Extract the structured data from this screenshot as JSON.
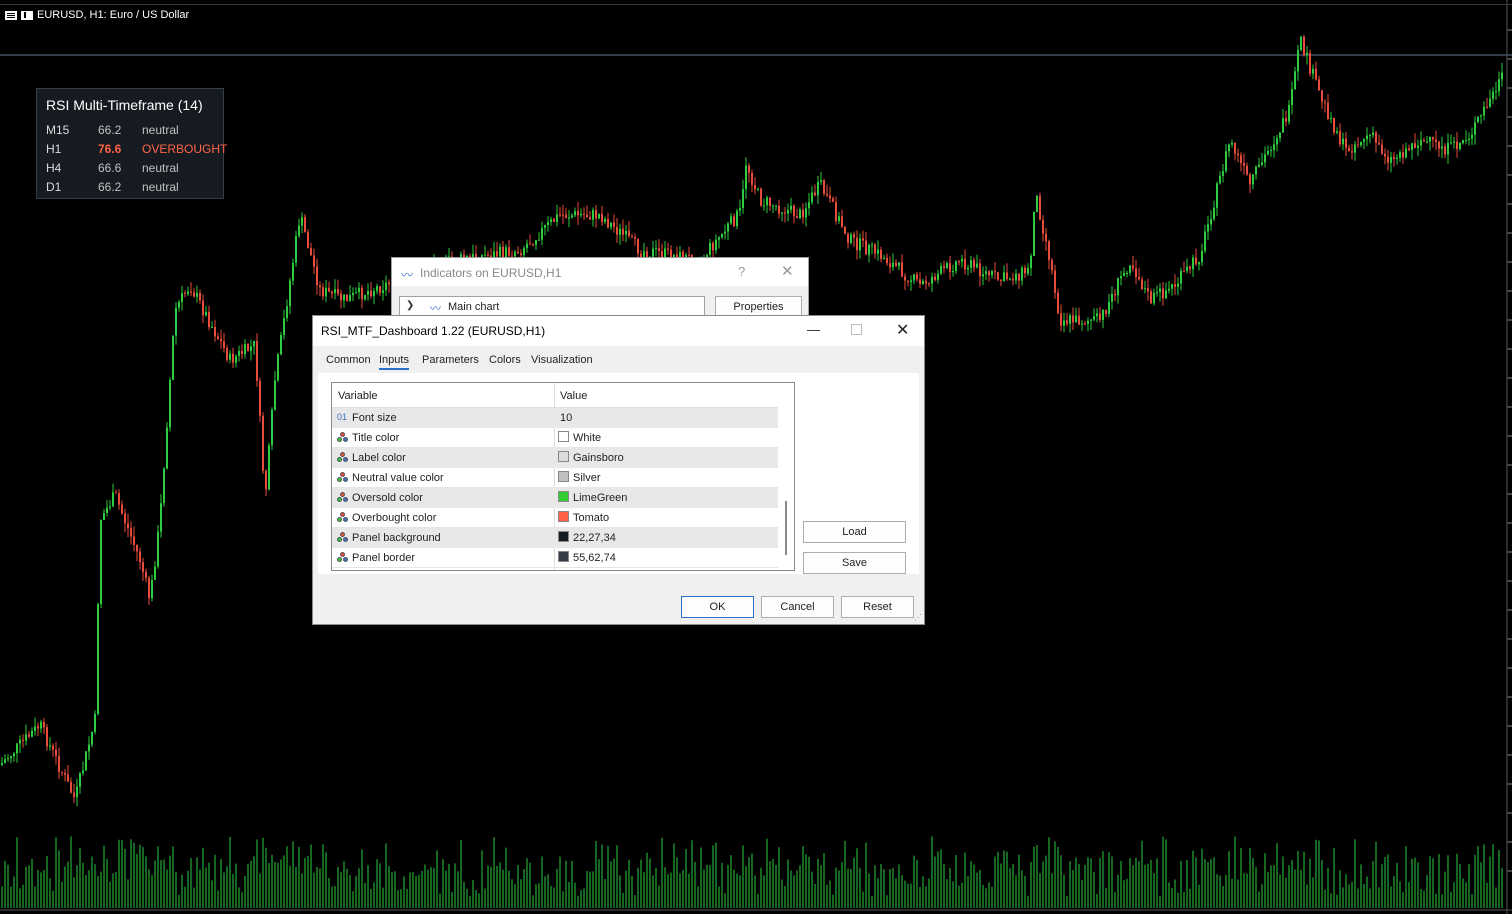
{
  "chart": {
    "symbol_title": "EURUSD, H1:  Euro / US Dollar",
    "colors": {
      "background": "#000000",
      "bull": "#2ecc40",
      "bear": "#e74c3c",
      "volume": "#2ecc40"
    }
  },
  "rsi_panel": {
    "title": "RSI Multi-Timeframe (14)",
    "rows": [
      {
        "tf": "M15",
        "value": "66.2",
        "state": "neutral"
      },
      {
        "tf": "H1",
        "value": "76.6",
        "state": "OVERBOUGHT"
      },
      {
        "tf": "H4",
        "value": "66.6",
        "state": "neutral"
      },
      {
        "tf": "D1",
        "value": "66.2",
        "state": "neutral"
      }
    ],
    "colors": {
      "background": "#161b22",
      "border": "#373e4a",
      "overbought": "#ff6347"
    }
  },
  "indicators_dialog": {
    "title": "Indicators on EURUSD,H1",
    "help": "?",
    "close": "✕",
    "combo_value": "Main chart",
    "properties_label": "Properties"
  },
  "props_dialog": {
    "title": "RSI_MTF_Dashboard 1.22 (EURUSD,H1)",
    "tabs": [
      "Common",
      "Inputs",
      "Parameters",
      "Colors",
      "Visualization"
    ],
    "active_tab": "Inputs",
    "columns": {
      "variable": "Variable",
      "value": "Value"
    },
    "rows": [
      {
        "name": "Font size",
        "value": "10",
        "icon": "number-icon",
        "icon_text": "01"
      },
      {
        "name": "Title color",
        "value": "White",
        "swatch": "#ffffff",
        "icon": "palette-icon"
      },
      {
        "name": "Label color",
        "value": "Gainsboro",
        "swatch": "#dcdcdc",
        "icon": "palette-icon"
      },
      {
        "name": "Neutral value color",
        "value": "Silver",
        "swatch": "#c0c0c0",
        "icon": "palette-icon"
      },
      {
        "name": "Oversold color",
        "value": "LimeGreen",
        "swatch": "#32cd32",
        "icon": "palette-icon"
      },
      {
        "name": "Overbought color",
        "value": "Tomato",
        "swatch": "#ff6347",
        "icon": "palette-icon"
      },
      {
        "name": "Panel background",
        "value": "22,27,34",
        "swatch": "#161b22",
        "icon": "palette-icon"
      },
      {
        "name": "Panel border",
        "value": "55,62,74",
        "swatch": "#373e4a",
        "icon": "palette-icon"
      }
    ],
    "buttons": {
      "load": "Load",
      "save": "Save",
      "ok": "OK",
      "cancel": "Cancel",
      "reset": "Reset"
    },
    "window_controls": {
      "minimize": "—",
      "close": "✕"
    }
  }
}
